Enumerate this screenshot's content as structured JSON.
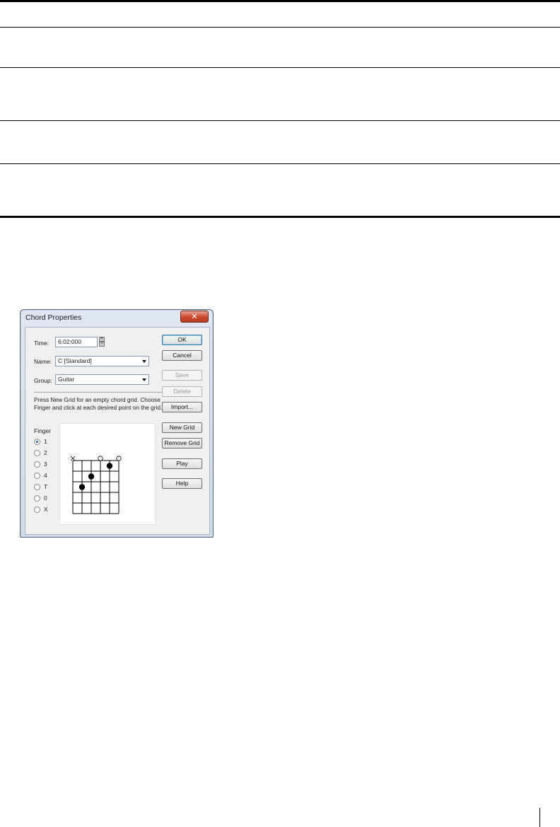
{
  "dialog": {
    "title": "Chord Properties",
    "close_icon": "close-icon",
    "time": {
      "label": "Time:",
      "value": "6:02:000"
    },
    "name": {
      "label": "Name:",
      "value": "C [Standard]"
    },
    "group": {
      "label": "Group:",
      "value": "Guitar"
    },
    "info_text": "Press New Grid for an empty chord grid. Choose Finger and click at each desired point on the grid.",
    "finger_label": "Finger",
    "finger_options": [
      "1",
      "2",
      "3",
      "4",
      "T",
      "0",
      "X"
    ],
    "finger_selected": "1",
    "buttons": {
      "ok": "OK",
      "cancel": "Cancel",
      "save": "Save",
      "delete": "Delete",
      "import": "Import...",
      "new_grid": "New Grid",
      "remove_grid": "Remove Grid",
      "play": "Play",
      "help": "Help"
    },
    "chord_grid": {
      "strings": 6,
      "frets": 5,
      "open_markers": [
        "X",
        "",
        "",
        "O",
        "",
        "O"
      ],
      "dots": [
        {
          "string": 2,
          "fret": 3
        },
        {
          "string": 3,
          "fret": 2
        },
        {
          "string": 5,
          "fret": 1
        }
      ]
    }
  }
}
